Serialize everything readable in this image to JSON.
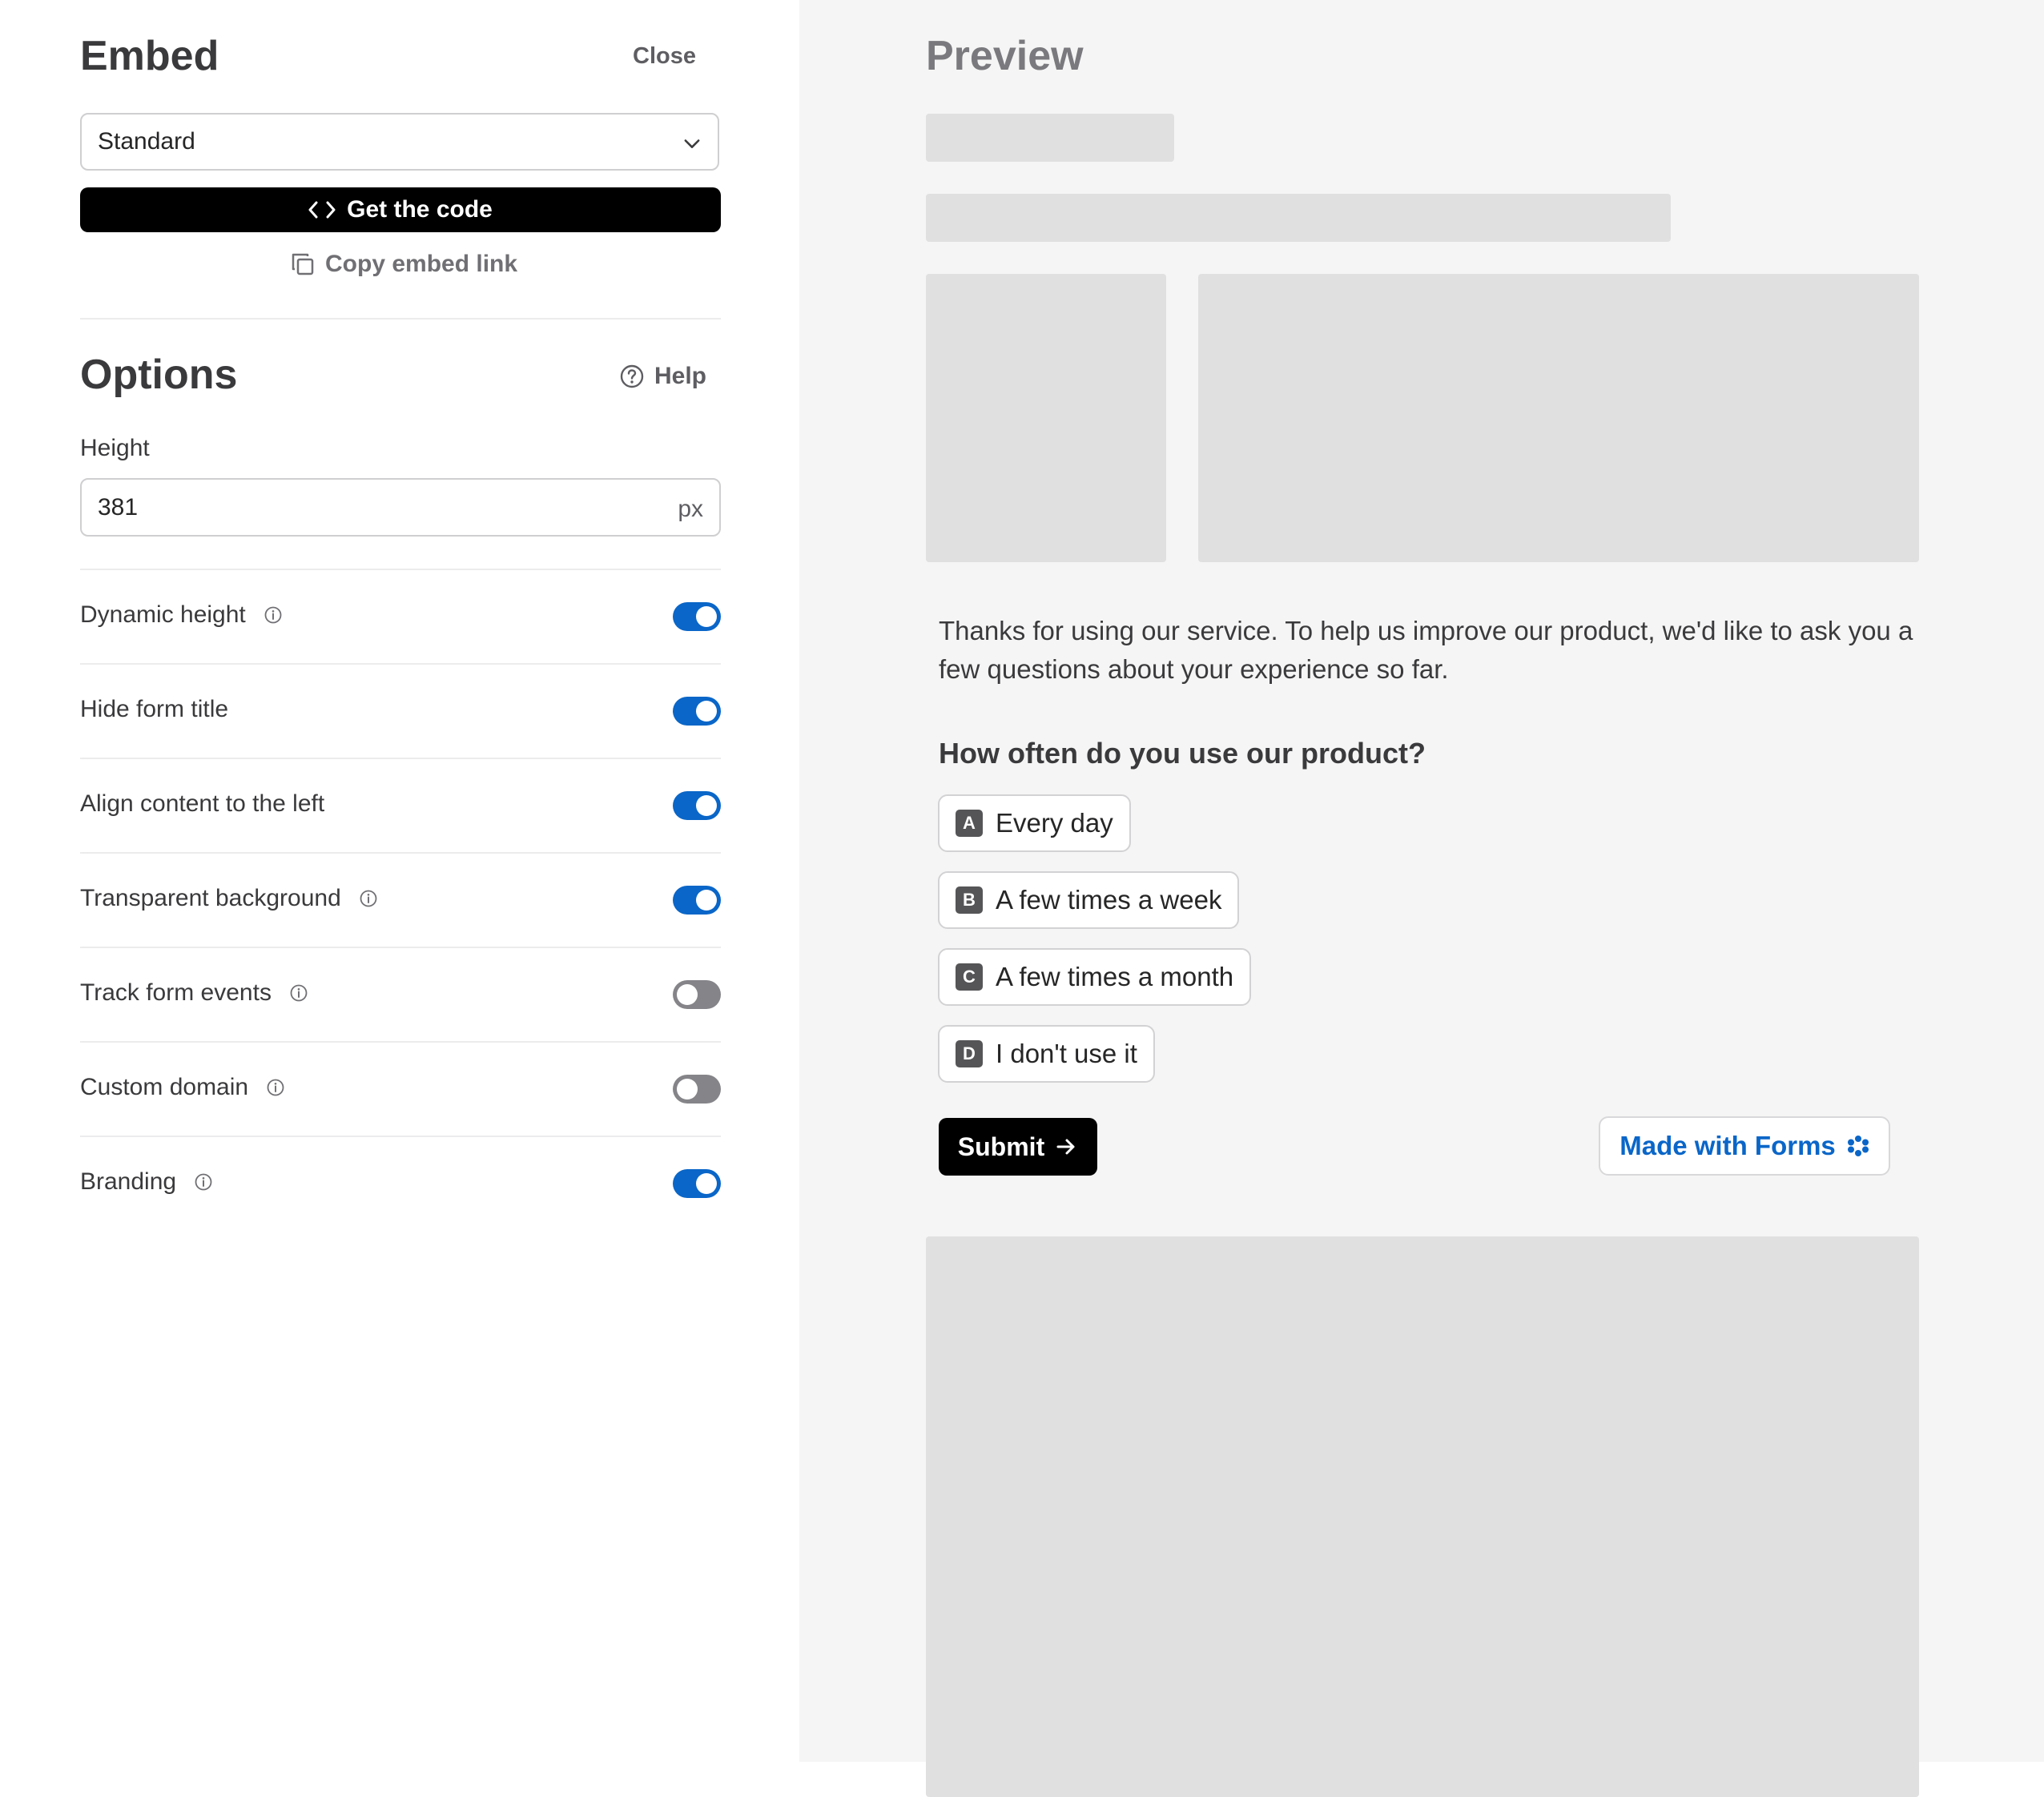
{
  "embed": {
    "title": "Embed",
    "close_label": "Close",
    "mode_select": {
      "selected": "Standard"
    },
    "get_code_label": "Get the code",
    "copy_link_label": "Copy embed link"
  },
  "options": {
    "title": "Options",
    "help_label": "Help",
    "height": {
      "label": "Height",
      "value": "381",
      "unit": "px"
    },
    "items": [
      {
        "label": "Dynamic height",
        "info": true,
        "enabled": true
      },
      {
        "label": "Hide form title",
        "info": false,
        "enabled": true
      },
      {
        "label": "Align content to the left",
        "info": false,
        "enabled": true
      },
      {
        "label": "Transparent background",
        "info": true,
        "enabled": true
      },
      {
        "label": "Track form events",
        "info": true,
        "enabled": false
      },
      {
        "label": "Custom domain",
        "info": true,
        "enabled": false
      },
      {
        "label": "Branding",
        "info": true,
        "enabled": true
      }
    ]
  },
  "preview": {
    "title": "Preview",
    "intro_text": "Thanks for using our service. To help us improve our product, we'd like to ask you a few questions about your experience so far.",
    "question": "How often do you use our product?",
    "choices": [
      {
        "key": "A",
        "label": "Every day"
      },
      {
        "key": "B",
        "label": "A few times a week"
      },
      {
        "key": "C",
        "label": "A few times a month"
      },
      {
        "key": "D",
        "label": "I don't use it"
      }
    ],
    "submit_label": "Submit",
    "branding_label": "Made with Forms"
  },
  "colors": {
    "accent": "#0a66c8",
    "toggle_off": "#858589",
    "preview_bg": "#f5f5f5",
    "skeleton": "#e0e0e0"
  }
}
